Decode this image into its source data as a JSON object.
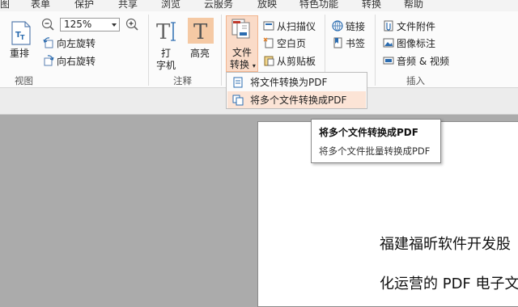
{
  "menubar": {
    "items": [
      "图",
      "表单",
      "保护",
      "共享",
      "浏览",
      "云服务",
      "放映",
      "特色功能",
      "转换",
      "帮助"
    ]
  },
  "view_group": {
    "rearrange_label": "重排",
    "zoom_value": "125%",
    "rotate_left": "向左旋转",
    "rotate_right": "向右旋转",
    "group_label": "视图"
  },
  "annotation_group": {
    "typewriter_label": "打\n字机",
    "highlight_label": "高亮",
    "group_label": "注释"
  },
  "convert_group": {
    "file_convert_label": "文件\n转换",
    "from_scanner": "从扫描仪",
    "blank_page": "空白页",
    "from_clipboard": "从剪贴板"
  },
  "links_group": {
    "link": "链接",
    "bookmark": "书签"
  },
  "insert_group": {
    "file_attachment": "文件附件",
    "image_annotation": "图像标注",
    "audio_video": "音频 & 视频",
    "group_label": "插入"
  },
  "dropdown": {
    "items": [
      "将文件转换为PDF",
      "将多个文件转换成PDF"
    ]
  },
  "tooltip": {
    "title": "将多个文件转换成PDF",
    "description": "将多个文件批量转换成PDF"
  },
  "document": {
    "line1": "福建福昕软件开发股",
    "line2": "化运营的 PDF 电子文"
  },
  "colors": {
    "highlight_orange": "#f5c9a4",
    "accent_blue": "#2b6cb0"
  }
}
